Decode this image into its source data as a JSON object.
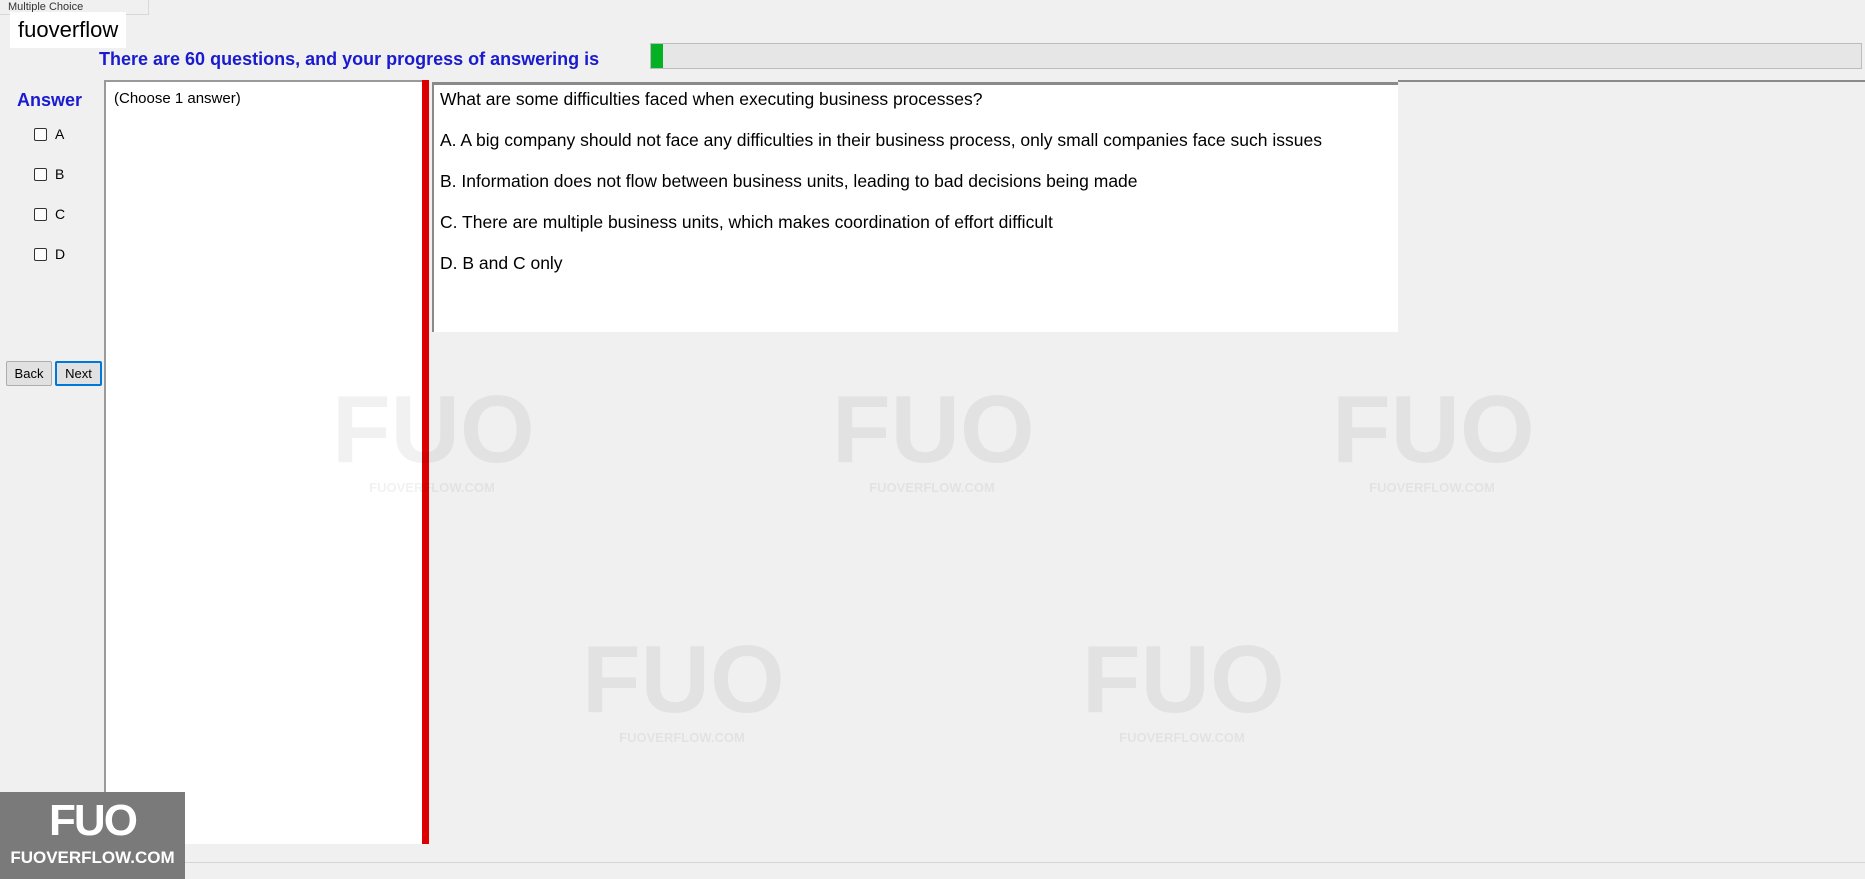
{
  "window": {
    "title_fragment": "Multiple Choice"
  },
  "brand": {
    "label": "fuoverflow"
  },
  "progress": {
    "text": "There are 60 questions, and your progress of answering is",
    "fraction": 0.01
  },
  "answer": {
    "heading": "Answer",
    "options": [
      "A",
      "B",
      "C",
      "D"
    ]
  },
  "nav": {
    "back_label": "Back",
    "next_label": "Next"
  },
  "left_panel": {
    "instruction": "(Choose 1 answer)"
  },
  "question": {
    "text": "What are some difficulties faced when executing business processes?",
    "choices": [
      "A.  A big company should not face any difficulties in their business process, only small companies face such issues",
      "B.  Information does not flow between business units, leading to bad decisions being made",
      "C.  There are multiple business units, which makes coordination of effort difficult",
      "D.  B and C only"
    ]
  },
  "watermark": {
    "mark": "FUO",
    "caption": "FUOVERFLOW.COM"
  },
  "logo": {
    "mark": "FUO",
    "caption": "FUOVERFLOW.COM"
  },
  "colors": {
    "accent_text": "#1a1ad0",
    "progress_fill": "#06b025",
    "divider": "#dd0000"
  }
}
